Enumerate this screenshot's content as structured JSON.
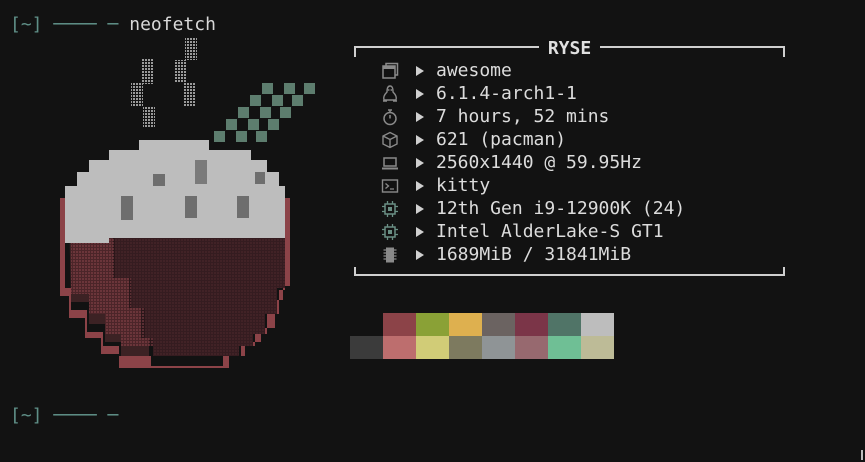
{
  "terminal": {
    "prompt_top": {
      "bracket": "[~]",
      "line": "──── ─",
      "command": "neofetch"
    },
    "prompt_bottom": {
      "bracket": "[~]",
      "line": "──── ─"
    }
  },
  "logo": {
    "description_icon": "rice-bowl-ascii-logo",
    "colors": {
      "bowl": "#8c4348",
      "rice": "#bdbdbd",
      "inside": "#3a1f23",
      "chopsticks": "#5d7d6e",
      "steam": "#9a9a9a"
    }
  },
  "info_box": {
    "title": "RYSE",
    "rows": [
      {
        "icon": "window-icon",
        "value": "awesome"
      },
      {
        "icon": "linux-penguin-icon",
        "value": "6.1.4-arch1-1"
      },
      {
        "icon": "stopwatch-icon",
        "value": "7 hours, 52 mins"
      },
      {
        "icon": "package-icon",
        "value": "621 (pacman)"
      },
      {
        "icon": "laptop-icon",
        "value": "2560x1440 @ 59.95Hz"
      },
      {
        "icon": "terminal-icon",
        "value": "kitty"
      },
      {
        "icon": "cpu-icon",
        "value": "12th Gen i9-12900K (24)"
      },
      {
        "icon": "gpu-chip-icon",
        "value": "Intel AlderLake-S GT1"
      },
      {
        "icon": "memory-icon",
        "value": "1689MiB / 31841MiB"
      }
    ],
    "icon_color": "#6a8f84"
  },
  "palette": {
    "normal": [
      "#8c4348",
      "#8aa136",
      "#deb04f",
      "#6b6361",
      "#7b3548",
      "#507467",
      "#bdbdbd"
    ],
    "bright": [
      "#3b3b3b",
      "#bd6e6e",
      "#d1cc77",
      "#7d7a5f",
      "#8f9496",
      "#97696f",
      "#6fbf95",
      "#bdbb97"
    ]
  }
}
